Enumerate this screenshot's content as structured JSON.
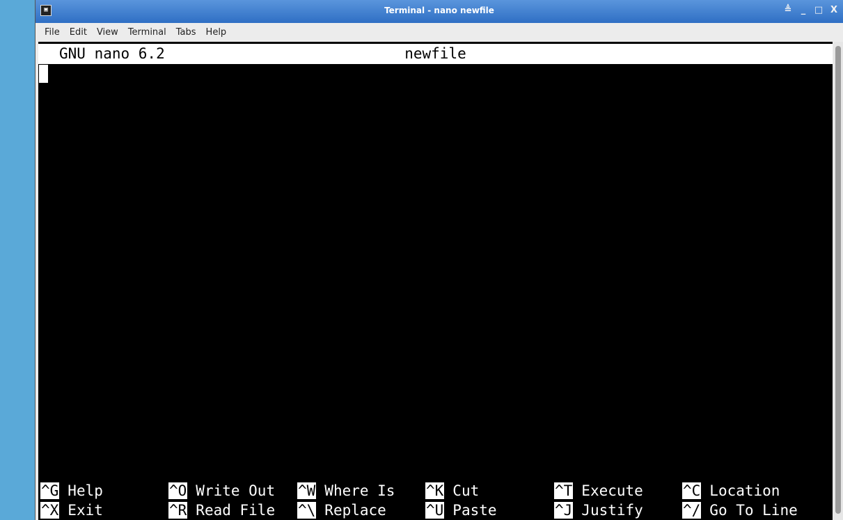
{
  "window": {
    "title": "Terminal - nano newfile",
    "app_icon_glyph": "▣",
    "controls": {
      "shade": "≜",
      "minimize": "_",
      "maximize": "□",
      "close": "X"
    }
  },
  "menubar": {
    "items": [
      "File",
      "Edit",
      "View",
      "Terminal",
      "Tabs",
      "Help"
    ]
  },
  "nano": {
    "version": "GNU nano 6.2",
    "filename": "newfile",
    "shortcuts_row1": [
      {
        "key": "^G",
        "label": "Help"
      },
      {
        "key": "^O",
        "label": "Write Out"
      },
      {
        "key": "^W",
        "label": "Where Is"
      },
      {
        "key": "^K",
        "label": "Cut"
      },
      {
        "key": "^T",
        "label": "Execute"
      },
      {
        "key": "^C",
        "label": "Location"
      }
    ],
    "shortcuts_row2": [
      {
        "key": "^X",
        "label": "Exit"
      },
      {
        "key": "^R",
        "label": "Read File"
      },
      {
        "key": "^\\",
        "label": "Replace"
      },
      {
        "key": "^U",
        "label": "Paste"
      },
      {
        "key": "^J",
        "label": "Justify"
      },
      {
        "key": "^/",
        "label": "Go To Line"
      }
    ]
  }
}
